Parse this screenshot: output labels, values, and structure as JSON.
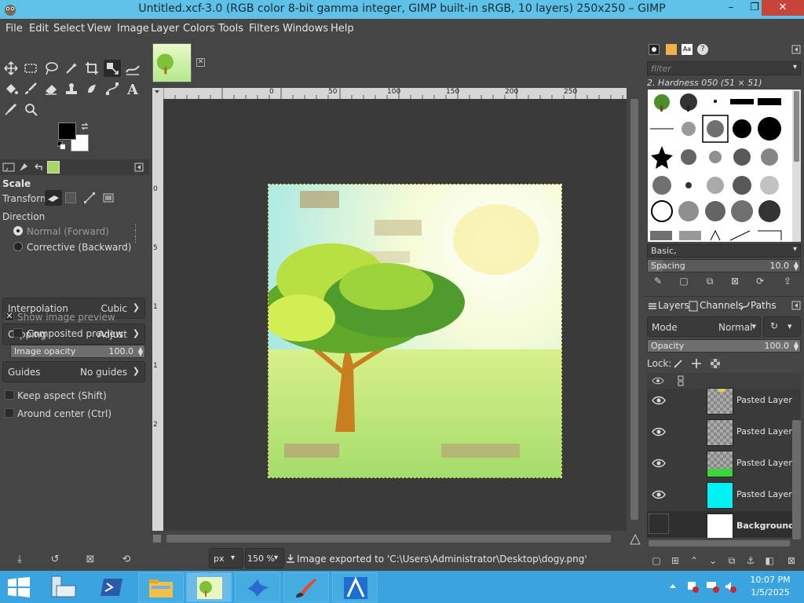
{
  "window": {
    "title": "Untitled.xcf-3.0 (RGB color 8-bit gamma integer, GIMP built-in sRGB, 10 layers) 250x250 – GIMP",
    "min": "–",
    "max": "❐",
    "close": "✕"
  },
  "menu": [
    "File",
    "Edit",
    "Select",
    "View",
    "Image",
    "Layer",
    "Colors",
    "Tools",
    "Filters",
    "Windows",
    "Help"
  ],
  "tool_options": {
    "title": "Scale",
    "transform_label": "Transform:",
    "direction_label": "Direction",
    "direction_normal": "Normal (Forward)",
    "direction_corrective": "Corrective (Backward)",
    "interpolation_label": "Interpolation",
    "interpolation_value": "Cubic",
    "clipping_label": "Clipping",
    "clipping_value": "Adjust",
    "show_preview": "Show image preview",
    "composited_preview": "Composited preview",
    "image_opacity_label": "Image opacity",
    "image_opacity_value": "100.0",
    "guides_label": "Guides",
    "guides_value": "No guides",
    "keep_aspect": "Keep aspect (Shift)",
    "around_center": "Around center (Ctrl)"
  },
  "rulers": {
    "top": [
      "0",
      "50",
      "100",
      "150",
      "200",
      "250"
    ],
    "left": [
      "0",
      "5",
      "1",
      "1",
      "2"
    ]
  },
  "statusbar": {
    "unit": "px",
    "zoom": "150 %",
    "message": "Image exported to 'C:\\Users\\Administrator\\Desktop\\dogy.png'"
  },
  "brushes": {
    "filter_placeholder": "filter",
    "selected_brush": "2. Hardness 050 (51 × 51)",
    "tag": "Basic,",
    "spacing_label": "Spacing",
    "spacing_value": "10.0",
    "spacing_fraction": 0.1
  },
  "layers": {
    "tabs": [
      "Layers",
      "Channels",
      "Paths"
    ],
    "mode_label": "Mode",
    "mode_value": "Normal",
    "opacity_label": "Opacity",
    "opacity_value": "100.0",
    "opacity_fraction": 1.0,
    "lock_label": "Lock:",
    "items": [
      {
        "name": "Pasted Layer",
        "visible": true,
        "thumb": "checker-yellow"
      },
      {
        "name": "Pasted Layer",
        "visible": true,
        "thumb": "checker"
      },
      {
        "name": "Pasted Layer",
        "visible": true,
        "thumb": "checker-green"
      },
      {
        "name": "Pasted Layer",
        "visible": true,
        "thumb": "cyan"
      },
      {
        "name": "Background",
        "visible": false,
        "thumb": "white"
      }
    ]
  },
  "taskbar": {
    "time": "10:07 PM",
    "date": "1/5/2025"
  },
  "colors": {
    "title_bar": "#5dc1e8",
    "taskbar": "#3aa4e0",
    "foreground": "#000000",
    "background": "#ffffff"
  }
}
